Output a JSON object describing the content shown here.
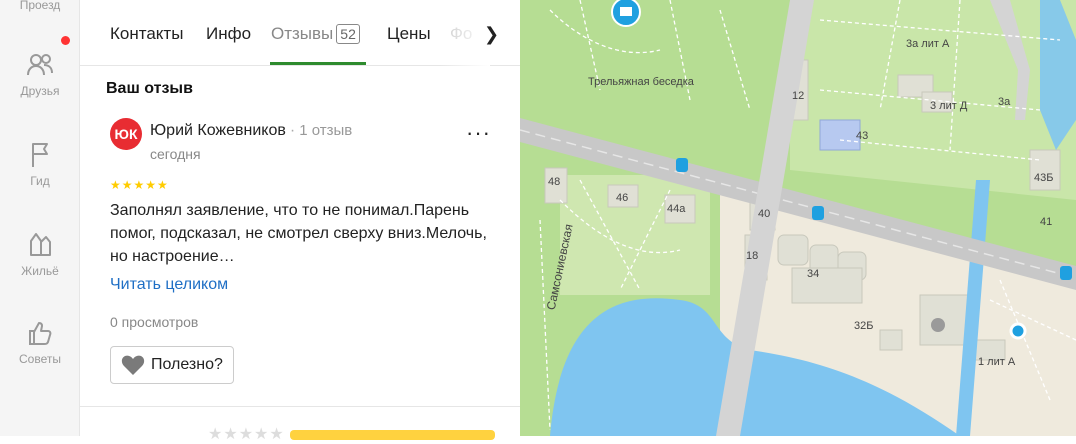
{
  "nav": {
    "items": [
      {
        "label": "Проезд"
      },
      {
        "label": "Друзья"
      },
      {
        "label": "Гид"
      },
      {
        "label": "Жильё"
      },
      {
        "label": "Советы"
      }
    ]
  },
  "tabs": {
    "contacts": "Контакты",
    "info": "Инфо",
    "reviews": "Отзывы",
    "reviews_count": "52",
    "prices": "Цены",
    "photos_partial": "Фо"
  },
  "review": {
    "section_title": "Ваш отзыв",
    "avatar_initials": "ЮК",
    "author": "Юрий Кожевников",
    "review_count": "1 отзыв",
    "date": "сегодня",
    "rating": 5,
    "stars": "★★★★★",
    "text": "Заполнял заявление, что то не понимал.Парень помог, подсказал, не смотрел сверху вниз.Мелочь, но настроение…",
    "read_more": "Читать целиком",
    "views": "0 просмотров",
    "useful": "Полезно?"
  },
  "bottom": {
    "stars": "★★★★★"
  },
  "map": {
    "labels": {
      "beseda": "Трельяжная беседка",
      "b12": "12",
      "b43": "43",
      "b3litA": "3а лит А",
      "b3litD": "3 лит Д",
      "b3a": "3а",
      "b43b": "43Б",
      "b48": "48",
      "b46": "46",
      "b44a": "44а",
      "b40": "40",
      "b41": "41",
      "b18": "18",
      "b34": "34",
      "b32b": "32Б",
      "b1litA": "1 лит А",
      "street": "Самсониевская"
    },
    "colors": {
      "park": "#b6dd93",
      "water": "#7fc5f0",
      "road": "#c8c8c8",
      "built": "#efeadd",
      "accent": "#1fa0e0"
    }
  }
}
